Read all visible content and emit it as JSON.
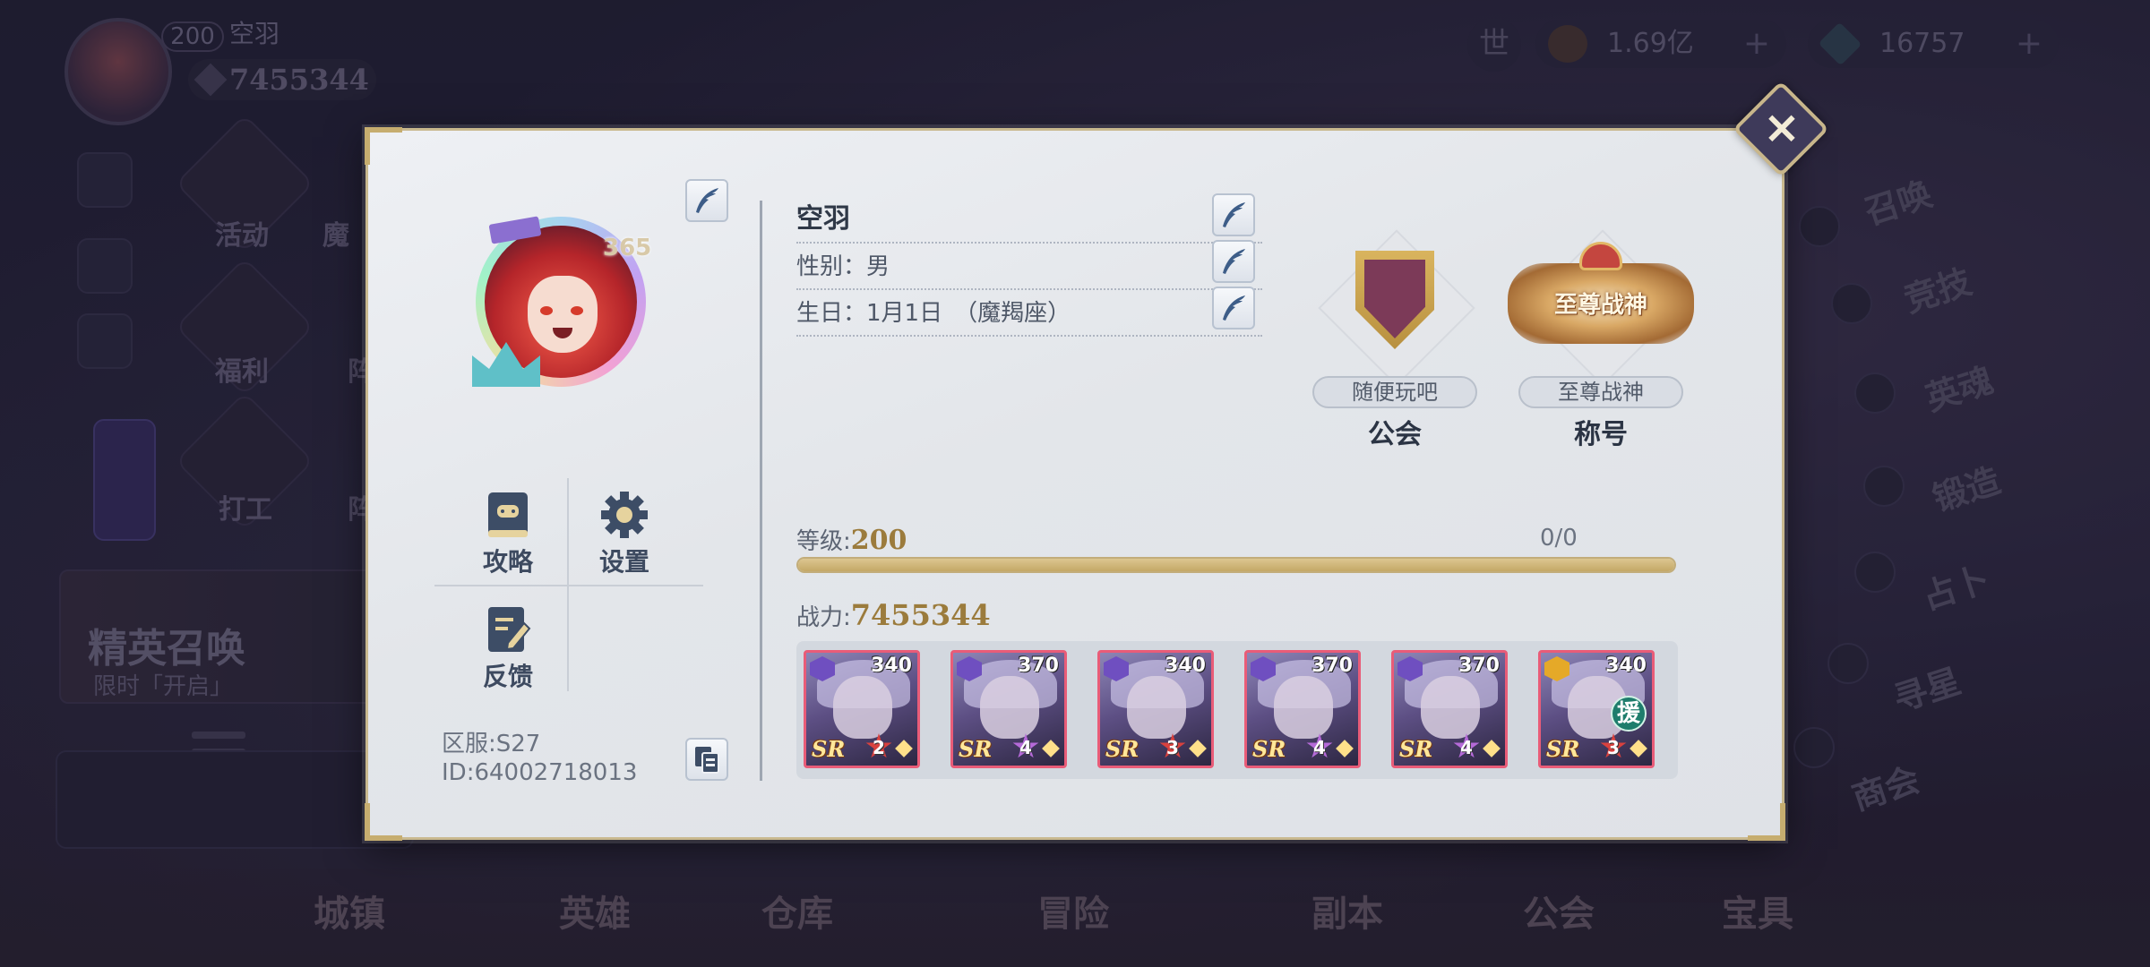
{
  "background": {
    "player": {
      "level": "200",
      "name": "空羽",
      "power": "7455344"
    },
    "resources": [
      {
        "name": "gold-coin",
        "value": "1.69亿",
        "plus": "+"
      },
      {
        "name": "diamond",
        "value": "16757",
        "plus": "+"
      }
    ],
    "world_button": "世",
    "left_features": [
      "活动",
      "魔",
      "福利",
      "阵",
      "打工",
      "阵"
    ],
    "banner": {
      "title": "精英召唤",
      "subtitle": "限时「开启」"
    },
    "right_menu": [
      "召唤",
      "竞技",
      "英魂",
      "锻造",
      "占卜",
      "寻星",
      "商会"
    ],
    "bottom_nav": [
      "城镇",
      "英雄",
      "仓库",
      "冒险",
      "副本",
      "公会",
      "宝具"
    ]
  },
  "profile": {
    "avatar_level": "365",
    "name": "空羽",
    "gender": "性别：男",
    "birthday": "生日：1月1日　（魔羯座）",
    "guild": {
      "name": "随便玩吧",
      "caption": "公会"
    },
    "title": {
      "name": "至尊战神",
      "badge_text": "至尊战神",
      "caption": "称号"
    },
    "tools": [
      {
        "label": "攻略",
        "icon": "guide-book-icon"
      },
      {
        "label": "设置",
        "icon": "gear-icon"
      },
      {
        "label": "反馈",
        "icon": "feedback-icon"
      }
    ],
    "server": "区服:S27",
    "player_id": "ID:64002718013",
    "level_label": "等级:",
    "level_value": "200",
    "exp": "0/0",
    "exp_fraction": 1.0,
    "power_label": "战力:",
    "power_value": "7455344",
    "heroes": [
      {
        "level": "340",
        "rarity": "SR",
        "stars": "2",
        "element": "purple",
        "support": false
      },
      {
        "level": "370",
        "rarity": "SR",
        "stars": "4",
        "element": "purple",
        "support": false
      },
      {
        "level": "340",
        "rarity": "SR",
        "stars": "3",
        "element": "purple",
        "support": false
      },
      {
        "level": "370",
        "rarity": "SR",
        "stars": "4",
        "element": "purple",
        "support": false
      },
      {
        "level": "370",
        "rarity": "SR",
        "stars": "4",
        "element": "purple",
        "support": false
      },
      {
        "level": "340",
        "rarity": "SR",
        "stars": "3",
        "element": "gold",
        "support": true,
        "support_label": "援"
      }
    ]
  },
  "close_button": "×",
  "colors": {
    "accent_gold": "#9b7b3c",
    "frame_gold": "#c9b98f",
    "card_border": "#e95c78"
  }
}
